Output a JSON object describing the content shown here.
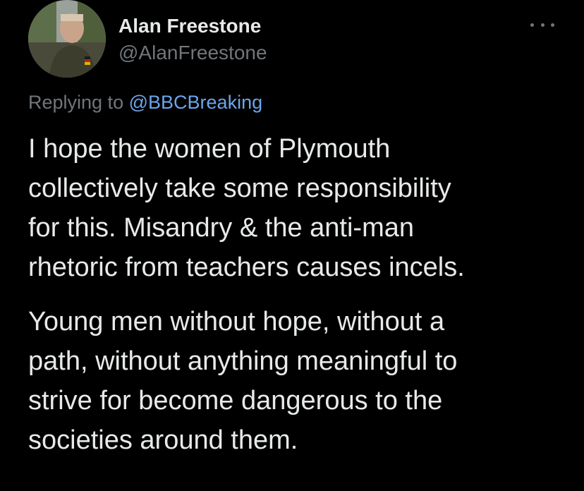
{
  "author": {
    "display_name": "Alan Freestone",
    "handle": "@AlanFreestone"
  },
  "more_menu": {
    "icon": "more-horizontal-icon"
  },
  "reply": {
    "prefix": "Replying to",
    "mention": "@BBCBreaking"
  },
  "tweet": {
    "paragraphs": [
      {
        "lines": [
          "I hope the women of Plymouth",
          "collectively take some responsibility",
          "for this. Misandry & the anti-man",
          "rhetoric from teachers causes incels."
        ]
      },
      {
        "lines": [
          "Young men without hope, without a",
          "path, without anything meaningful to",
          "strive for become dangerous to the",
          "societies around them."
        ]
      }
    ]
  },
  "colors": {
    "background": "#000000",
    "primary_text": "#e7e9ea",
    "secondary_text": "#71767b",
    "link": "#6ba6ec"
  }
}
